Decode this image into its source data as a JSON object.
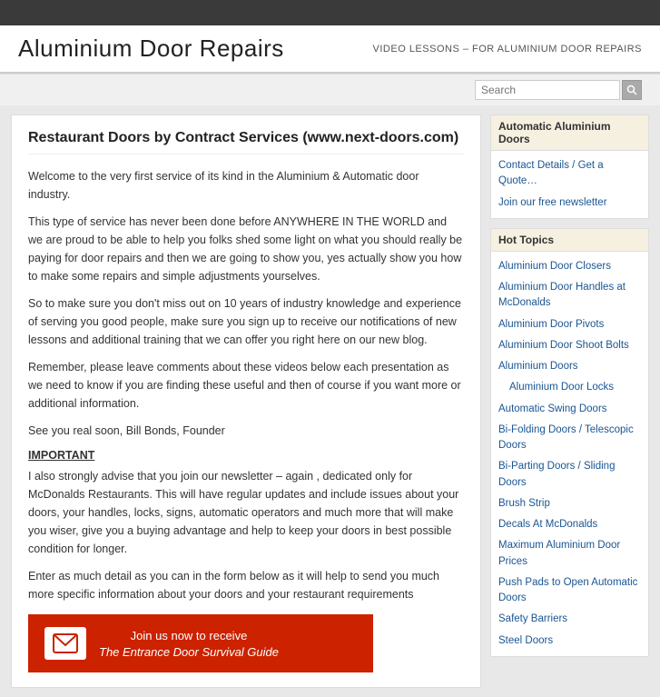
{
  "topbar": {},
  "header": {
    "site_title": "Aluminium Door Repairs",
    "tagline": "VIDEO LESSONS – FOR ALUMINIUM DOOR REPAIRS"
  },
  "search": {
    "placeholder": "Search",
    "button_label": "Go"
  },
  "article": {
    "title": "Restaurant Doors by Contract Services (www.next-doors.com)",
    "para1": "Welcome to the very first service of its kind in the Aluminium & Automatic door industry.",
    "para2": "This type of service has never been done before ANYWHERE IN THE WORLD and we are proud to be able to help you folks shed some light on what you should really be paying for door repairs and then we are going to show you, yes actually show you how to make some repairs and simple adjustments yourselves.",
    "para3": "So to make sure you don't miss out on 10 years of industry knowledge and experience of serving you good people, make sure you sign up to receive our notifications  of new lessons and additional training that we can offer you right here on our new blog.",
    "para4": "Remember, please leave comments about these videos below each presentation as we need to know if you are finding these useful and then of course if you want more or additional information.",
    "para5": "See you real soon, Bill Bonds, Founder",
    "important_label": "IMPORTANT",
    "para6": "I also strongly advise that you join our newsletter – again , dedicated only for McDonalds Restaurants.  This will have regular updates and include issues about your doors, your handles, locks, signs, automatic operators and much more that will make you wiser, give you a buying advantage and help to keep your doors in best possible condition for longer.",
    "para7": "Enter as much detail as you can in the form below as it will help to send you much more specific information about your doors and your restaurant requirements"
  },
  "cta": {
    "line1": "Join us now to receive",
    "line2": "The Entrance Door Survival Guide"
  },
  "sidebar": {
    "auto_doors_title": "Automatic Aluminium Doors",
    "auto_doors_links": [
      "Contact Details / Get a Quote…",
      "Join our free newsletter"
    ],
    "hot_topics_title": "Hot Topics",
    "hot_topics_links": [
      {
        "label": "Aluminium Door Closers",
        "indent": false
      },
      {
        "label": "Aluminium Door Handles at McDonalds",
        "indent": false
      },
      {
        "label": "Aluminium Door Pivots",
        "indent": false
      },
      {
        "label": "Aluminium Door Shoot Bolts",
        "indent": false
      },
      {
        "label": "Aluminium Doors",
        "indent": false
      },
      {
        "label": "Aluminium Door Locks",
        "indent": true
      },
      {
        "label": "Automatic Swing Doors",
        "indent": false
      },
      {
        "label": "Bi-Folding Doors / Telescopic Doors",
        "indent": false
      },
      {
        "label": "Bi-Parting Doors / Sliding Doors",
        "indent": false
      },
      {
        "label": "Brush Strip",
        "indent": false
      },
      {
        "label": "Decals At McDonalds",
        "indent": false
      },
      {
        "label": "Maximum Aluminium Door Prices",
        "indent": false
      },
      {
        "label": "Push Pads to Open Automatic Doors",
        "indent": false
      },
      {
        "label": "Safety Barriers",
        "indent": false
      },
      {
        "label": "Steel Doors",
        "indent": false
      }
    ]
  }
}
